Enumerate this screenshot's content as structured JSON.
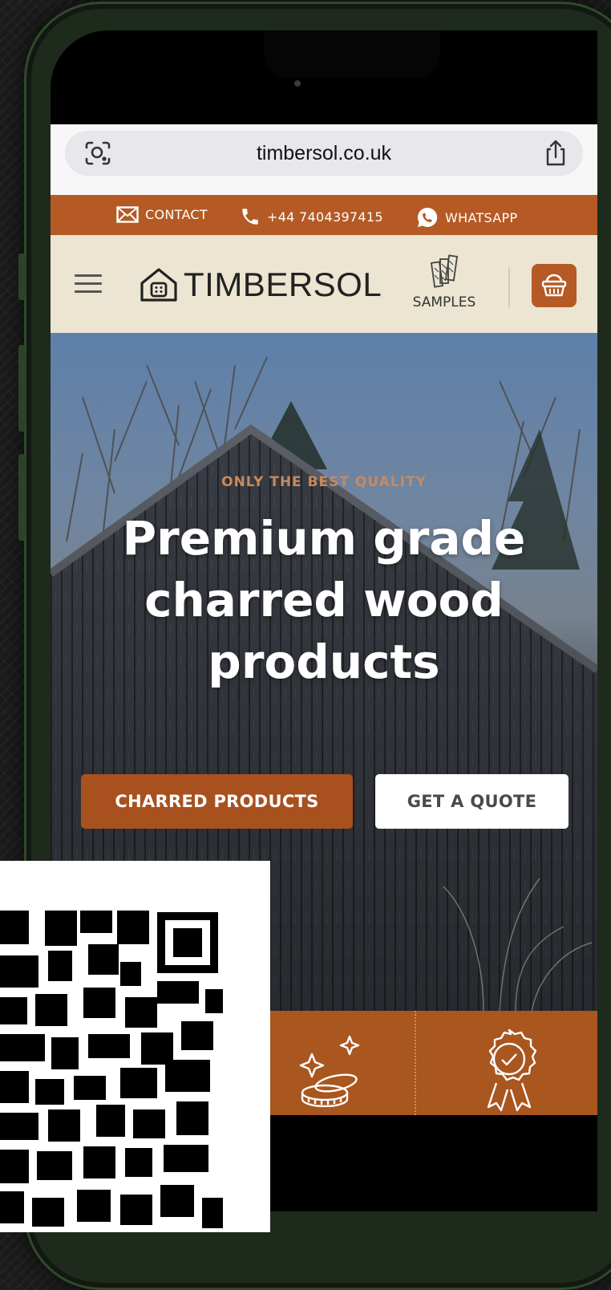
{
  "browser": {
    "url": "timbersol.co.uk",
    "icons": {
      "left": "visual-search-icon",
      "right": "share-icon"
    }
  },
  "contact_bar": {
    "contact_label": "CONTACT",
    "phone_label": "+44 7404397415",
    "whatsapp_label": "WHATSAPP",
    "icons": [
      "mail-icon",
      "phone-icon",
      "whatsapp-icon"
    ]
  },
  "nav": {
    "logo_text": "TIMBERSOL",
    "samples_label": "SAMPLES",
    "icons": [
      "hamburger-menu-icon",
      "house-logo-icon",
      "wood-samples-icon",
      "basket-icon"
    ]
  },
  "hero": {
    "eyebrow": "ONLY THE BEST QUALITY",
    "headline_line1": "Premium grade",
    "headline_line2": "charred wood",
    "headline_line3": "products",
    "primary_button": "CHARRED PRODUCTS",
    "secondary_button": "GET A QUOTE"
  },
  "features": {
    "icons": [
      "coins-sparkle-icon",
      "quality-badge-icon"
    ]
  },
  "colors": {
    "accent": "#b55a24",
    "nav_background": "#ebe5d2",
    "primary_button": "#a9501f",
    "headline": "#ffffff",
    "eyebrow": "#c78a5e"
  }
}
